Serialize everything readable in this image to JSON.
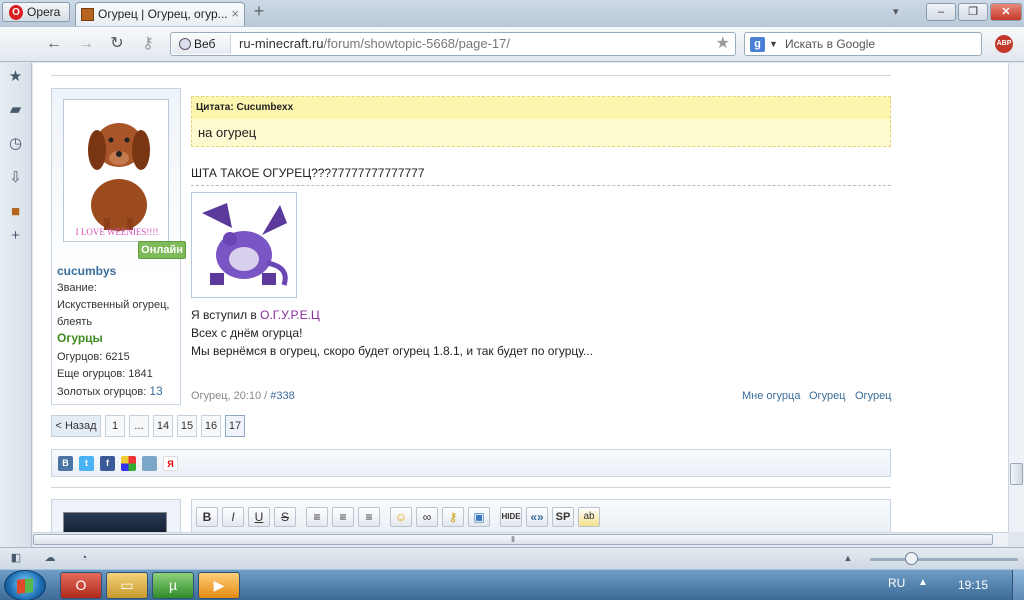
{
  "browser": {
    "menu_label": "Opera",
    "tab_title": "Огурец | Огурец, огур...",
    "new_tab": "+",
    "close_tab": "×",
    "address_badge": "Веб",
    "url_host": "ru-minecraft.ru",
    "url_path": "/forum/showtopic-5668/page-17/",
    "search_placeholder": "Искать в Google",
    "search_engine_glyph": "g",
    "adblock_label": "ABP"
  },
  "user": {
    "avatar_caption": "I LOVE WEENIES!!!!",
    "online_badge": "Онлайн",
    "name": "cucumbys",
    "rank_label": "Звание:",
    "rank_line1": "Искуственный огурец,",
    "rank_line2": "блеять",
    "group": "Огурцы",
    "stat1": "Огурцов: 6215",
    "stat2": "Еще огурцов: 1841",
    "stat3_label": "Золотых огурцов:",
    "stat3_value": "13"
  },
  "post": {
    "quote_header": "Цитата: Cucumbexx",
    "quote_body": "на огурец",
    "text1": "ШТА ТАКОЕ ОГУРЕЦ???77777777777777",
    "line1_prefix": "Я вступил в ",
    "line1_link": "О.Г.У.Р.Е.Ц",
    "line2": "Всех с днём огурца!",
    "line3": "Мы вернёмся в огурец, скоро будет огурец 1.8.1, и так будет по огурцу..."
  },
  "post_footer": {
    "time": "Огурец, 20:10 / ",
    "post_number": "#338",
    "link1": "Мне огурца",
    "link2": "Огурец",
    "link3": "Огурец"
  },
  "pagination": {
    "back": "< Назад",
    "pages": [
      "1",
      "...",
      "14",
      "15",
      "16",
      "17"
    ],
    "current": "17"
  },
  "share": [
    "В",
    "t",
    "f",
    "",
    "",
    "Я"
  ],
  "editor_buttons": [
    "B",
    "I",
    "U",
    "S",
    "",
    "",
    "",
    "",
    "",
    "",
    "",
    "HIDE",
    "«»",
    "SP",
    "ab"
  ],
  "taskbar": {
    "language": "RU",
    "time": "19:15"
  }
}
